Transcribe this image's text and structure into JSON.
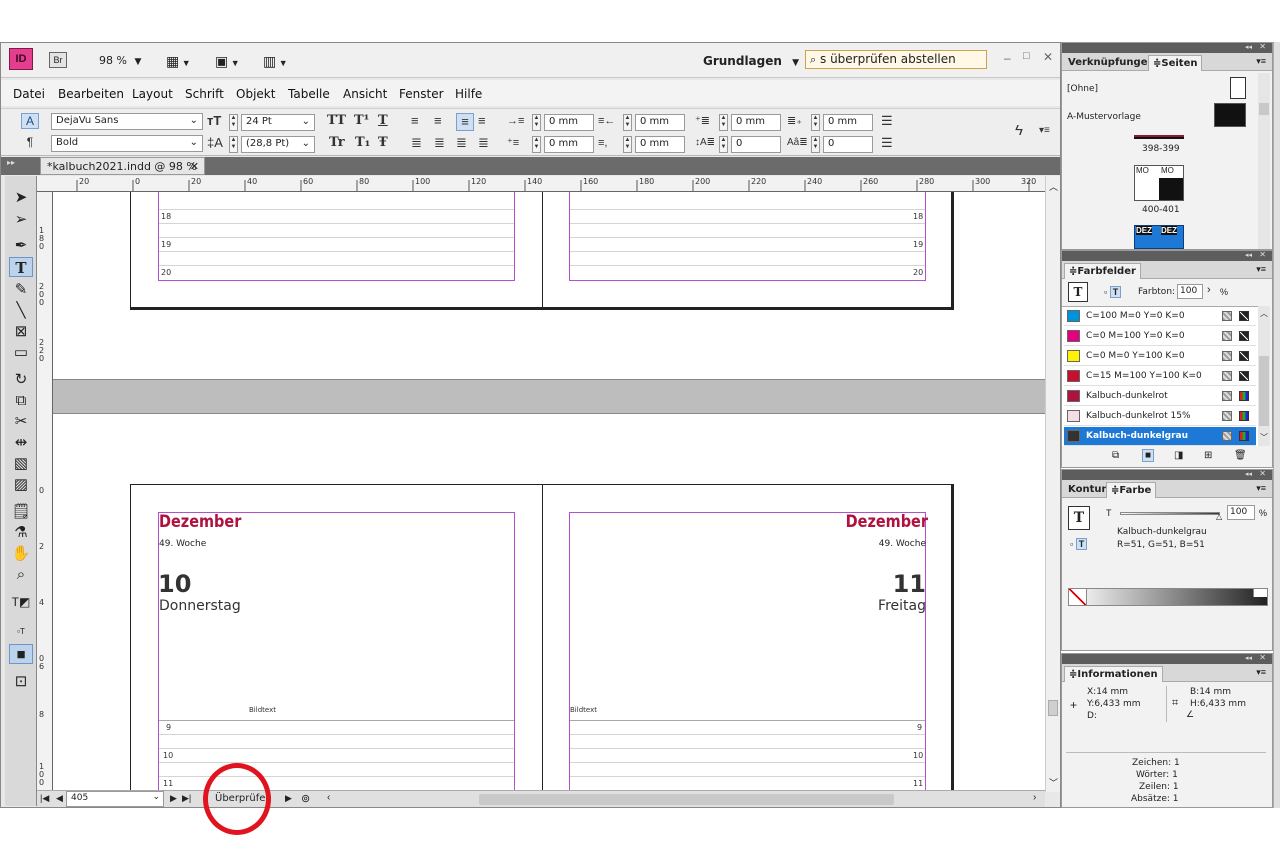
{
  "appbar": {
    "app_logo": "ID",
    "bridge_logo": "Br",
    "zoom": "98 %",
    "workspace": "Grundlagen",
    "search_value": "s überprüfen abstellen"
  },
  "menu": [
    "Datei",
    "Bearbeiten",
    "Layout",
    "Schrift",
    "Objekt",
    "Tabelle",
    "Ansicht",
    "Fenster",
    "Hilfe"
  ],
  "control": {
    "font": "DejaVu Sans",
    "style": "Bold",
    "size": "24 Pt",
    "leading": "(28,8 Pt)",
    "caps": [
      "TT",
      "T¹",
      "T",
      "Tr",
      "T₁",
      "Ŧ"
    ],
    "indent_fields": [
      "0 mm",
      "0 mm",
      "0 mm",
      "0 mm"
    ],
    "indent_fields2": [
      "0 mm",
      "0 mm",
      "0",
      "0"
    ]
  },
  "document": {
    "tab_title": "*kalbuch2021.indd @ 98 %"
  },
  "ruler": {
    "h_ticks": [
      "20",
      "0",
      "20",
      "40",
      "60",
      "80",
      "100",
      "120",
      "140",
      "160",
      "180",
      "200",
      "220",
      "240",
      "260",
      "280",
      "300",
      "320"
    ],
    "v_labels": [
      "1",
      "8",
      "0",
      "2",
      "0",
      "0",
      "2",
      "2",
      "0",
      "0",
      "2",
      "4",
      "0",
      "6",
      "8",
      "1",
      "0",
      "0"
    ]
  },
  "spread_top": {
    "left_lines": [
      "18",
      "19",
      "20"
    ],
    "right_lines": [
      "18",
      "19",
      "20"
    ]
  },
  "spread_bottom": {
    "left": {
      "month": "Dezember",
      "week": "49. Woche",
      "day_num": "10",
      "day_name": "Donnerstag",
      "caption": "Bildtext",
      "lines": [
        "9",
        "10",
        "11"
      ]
    },
    "right": {
      "month": "Dezember",
      "week": "49. Woche",
      "day_num": "11",
      "day_name": "Freitag",
      "caption": "Bildtext",
      "lines": [
        "9",
        "10",
        "11"
      ]
    }
  },
  "status": {
    "page": "405",
    "preflight": "Überprüfen"
  },
  "pages_panel": {
    "tabs": [
      "Verknüpfungen",
      "Seiten"
    ],
    "none_label": "[Ohne]",
    "master_label": "A-Mustervorlage",
    "spreads": [
      "398-399",
      "400-401"
    ],
    "thumb_labels": [
      "MO",
      "MO",
      "DEZ",
      "DEZ"
    ]
  },
  "swatches_panel": {
    "title": "Farbfelder",
    "tint_label": "Farbton:",
    "tint_value": "100",
    "tint_unit": "%",
    "rows": [
      {
        "name": "C=100 M=0 Y=0 K=0",
        "color": "#0093dd"
      },
      {
        "name": "C=0 M=100 Y=0 K=0",
        "color": "#e4007d"
      },
      {
        "name": "C=0 M=0 Y=100 K=0",
        "color": "#fff200"
      },
      {
        "name": "C=15 M=100 Y=100 K=0",
        "color": "#c8102e"
      },
      {
        "name": "Kalbuch-dunkelrot",
        "color": "#b0123f"
      },
      {
        "name": "Kalbuch-dunkelrot 15%",
        "color": "#f4dde3"
      },
      {
        "name": "Kalbuch-dunkelgrau",
        "color": "#333333"
      }
    ]
  },
  "color_panel": {
    "tabs": [
      "Kontur",
      "Farbe"
    ],
    "t_label": "T",
    "value": "100",
    "unit": "%",
    "swatch_name": "Kalbuch-dunkelgrau",
    "rgb": "R=51, G=51, B=51"
  },
  "info_panel": {
    "title": "Informationen",
    "x": "X:14 mm",
    "y": "Y:6,433 mm",
    "d": "D:",
    "b": "B:14 mm",
    "h": "H:6,433 mm",
    "chars": "Zeichen: 1",
    "words": "Wörter: 1",
    "lines": "Zeilen: 1",
    "paras": "Absätze: 1"
  },
  "colors": {
    "accent_red": "#b0123f",
    "margin_guide": "#b34fd1",
    "highlight_circle": "#e0141e",
    "selection": "#1e78d6"
  }
}
